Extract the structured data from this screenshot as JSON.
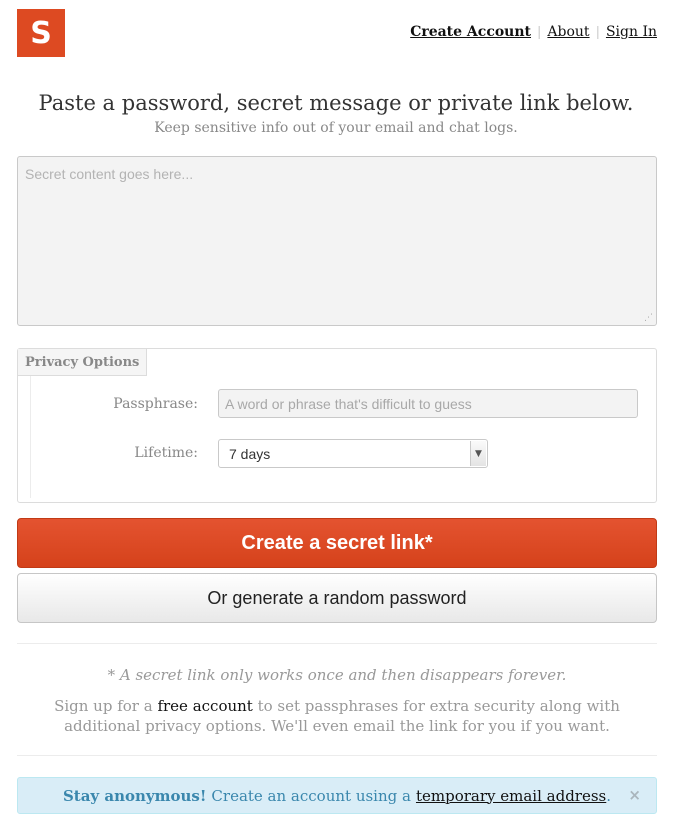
{
  "brand": {
    "logo_letter": "S",
    "color": "#dd4a22"
  },
  "nav": {
    "create_account": "Create Account",
    "about": "About",
    "sign_in": "Sign In",
    "separator": "|"
  },
  "intro": {
    "headline": "Paste a password, secret message or private link below.",
    "subhead": "Keep sensitive info out of your email and chat logs."
  },
  "secret": {
    "placeholder": "Secret content goes here...",
    "value": ""
  },
  "privacy": {
    "legend": "Privacy Options",
    "passphrase_label": "Passphrase:",
    "passphrase_placeholder": "A word or phrase that's difficult to guess",
    "lifetime_label": "Lifetime:",
    "lifetime_value": "7 days"
  },
  "actions": {
    "create_link": "Create a secret link*",
    "generate_password": "Or generate a random password"
  },
  "info": {
    "footnote": "* A secret link only works once and then disappears forever.",
    "signup_before": "Sign up for a ",
    "signup_link": "free account",
    "signup_after": " to set passphrases for extra security along with additional privacy options. We'll even email the link for you if you want."
  },
  "alert": {
    "bold": "Stay anonymous!",
    "text": "Create an account using a",
    "link": "temporary email address",
    "period": ".",
    "close": "×",
    "background": "#d9edf7"
  }
}
